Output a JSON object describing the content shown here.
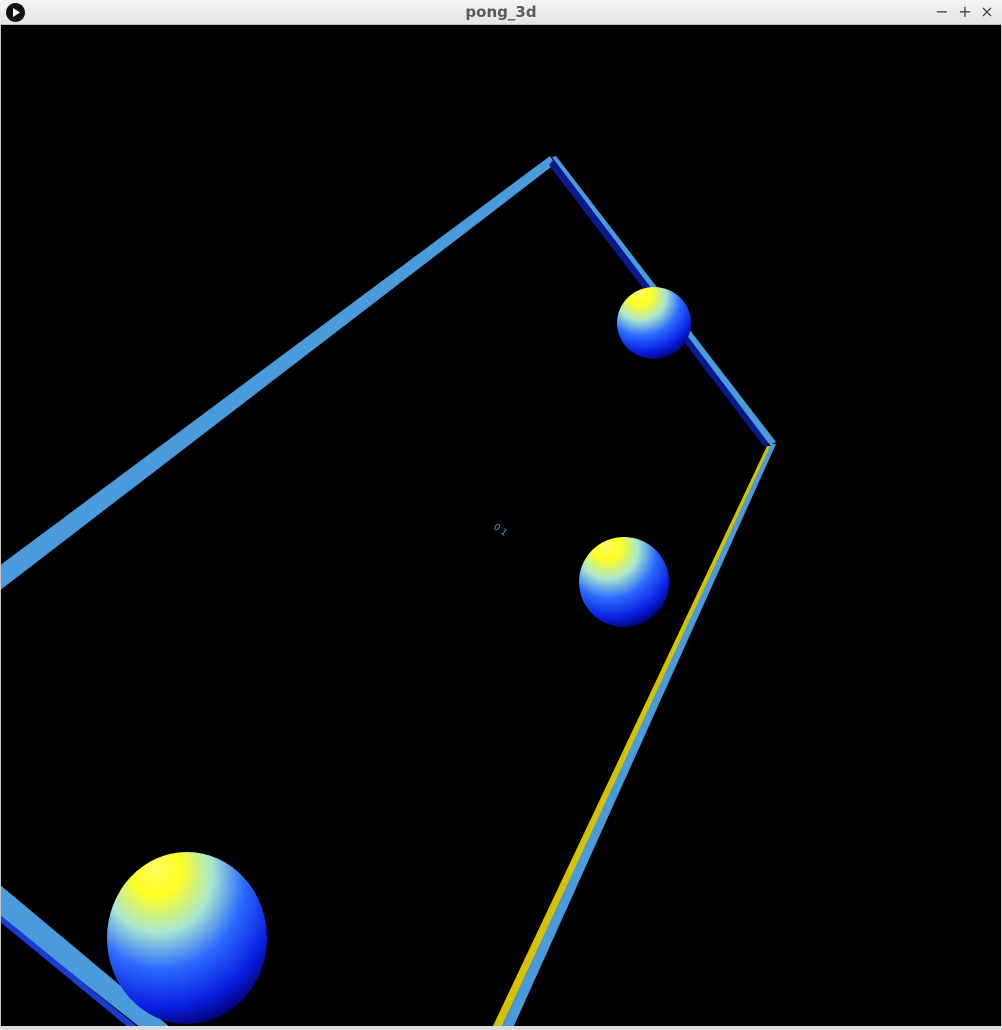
{
  "window": {
    "title": "pong_3d",
    "minimize_label": "−",
    "maximize_label": "+",
    "close_label": "×",
    "app_icon": "play-icon"
  },
  "scene": {
    "background": "#000000",
    "frame_color": "#4a9bdc",
    "dark_edge_color": "#0a1a8c",
    "right_paddle_color": "#d4c200",
    "ball_colors": [
      "#ffff33",
      "#1e5bff",
      "#00008a"
    ],
    "score_text": "0 1"
  }
}
